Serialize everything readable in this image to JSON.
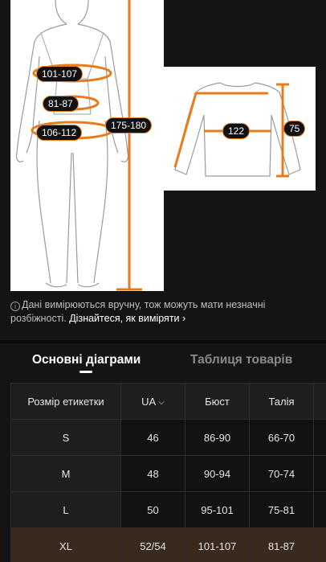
{
  "figure": {
    "labels": {
      "bust": "101-107",
      "waist": "81-87",
      "hips": "106-112",
      "height": "175-180"
    }
  },
  "shirt": {
    "labels": {
      "chest": "122",
      "length": "75"
    }
  },
  "info": {
    "icon": "info-icon",
    "text": "Дані вимірюються вручну, тож можуть мати незначні розбіжності.",
    "link": "Дізнайтеся, як виміряти",
    "link_chevron": "›"
  },
  "tabs": {
    "main": "Основні діаграми",
    "products": "Таблиця товарів"
  },
  "table": {
    "headers": {
      "size": "Розмір етикетки",
      "ua": "UA",
      "bust": "Бюст",
      "waist": "Талія"
    },
    "rows": [
      {
        "size": "S",
        "ua": "46",
        "bust": "86-90",
        "waist": "66-70"
      },
      {
        "size": "M",
        "ua": "48",
        "bust": "90-94",
        "waist": "70-74"
      },
      {
        "size": "L",
        "ua": "50",
        "bust": "95-101",
        "waist": "75-81"
      },
      {
        "size": "XL",
        "ua": "52/54",
        "bust": "101-107",
        "waist": "81-87"
      }
    ],
    "highlight_color": "#3a2a1d"
  },
  "colors": {
    "accent": "#e87b1c"
  }
}
